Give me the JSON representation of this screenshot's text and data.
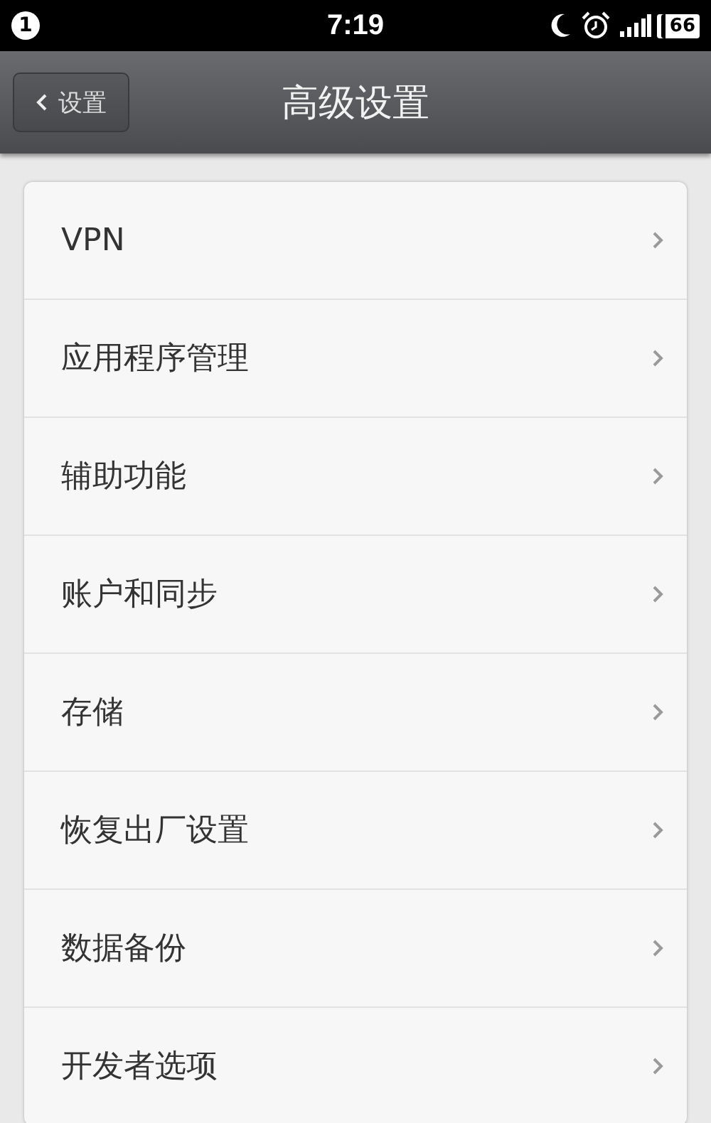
{
  "status_bar": {
    "notification_count": "1",
    "time": "7:19",
    "battery": "66"
  },
  "header": {
    "back_label": "设置",
    "title": "高级设置"
  },
  "items": [
    {
      "label": "VPN"
    },
    {
      "label": "应用程序管理"
    },
    {
      "label": "辅助功能"
    },
    {
      "label": "账户和同步"
    },
    {
      "label": "存储"
    },
    {
      "label": "恢复出厂设置"
    },
    {
      "label": "数据备份"
    },
    {
      "label": "开发者选项"
    }
  ]
}
